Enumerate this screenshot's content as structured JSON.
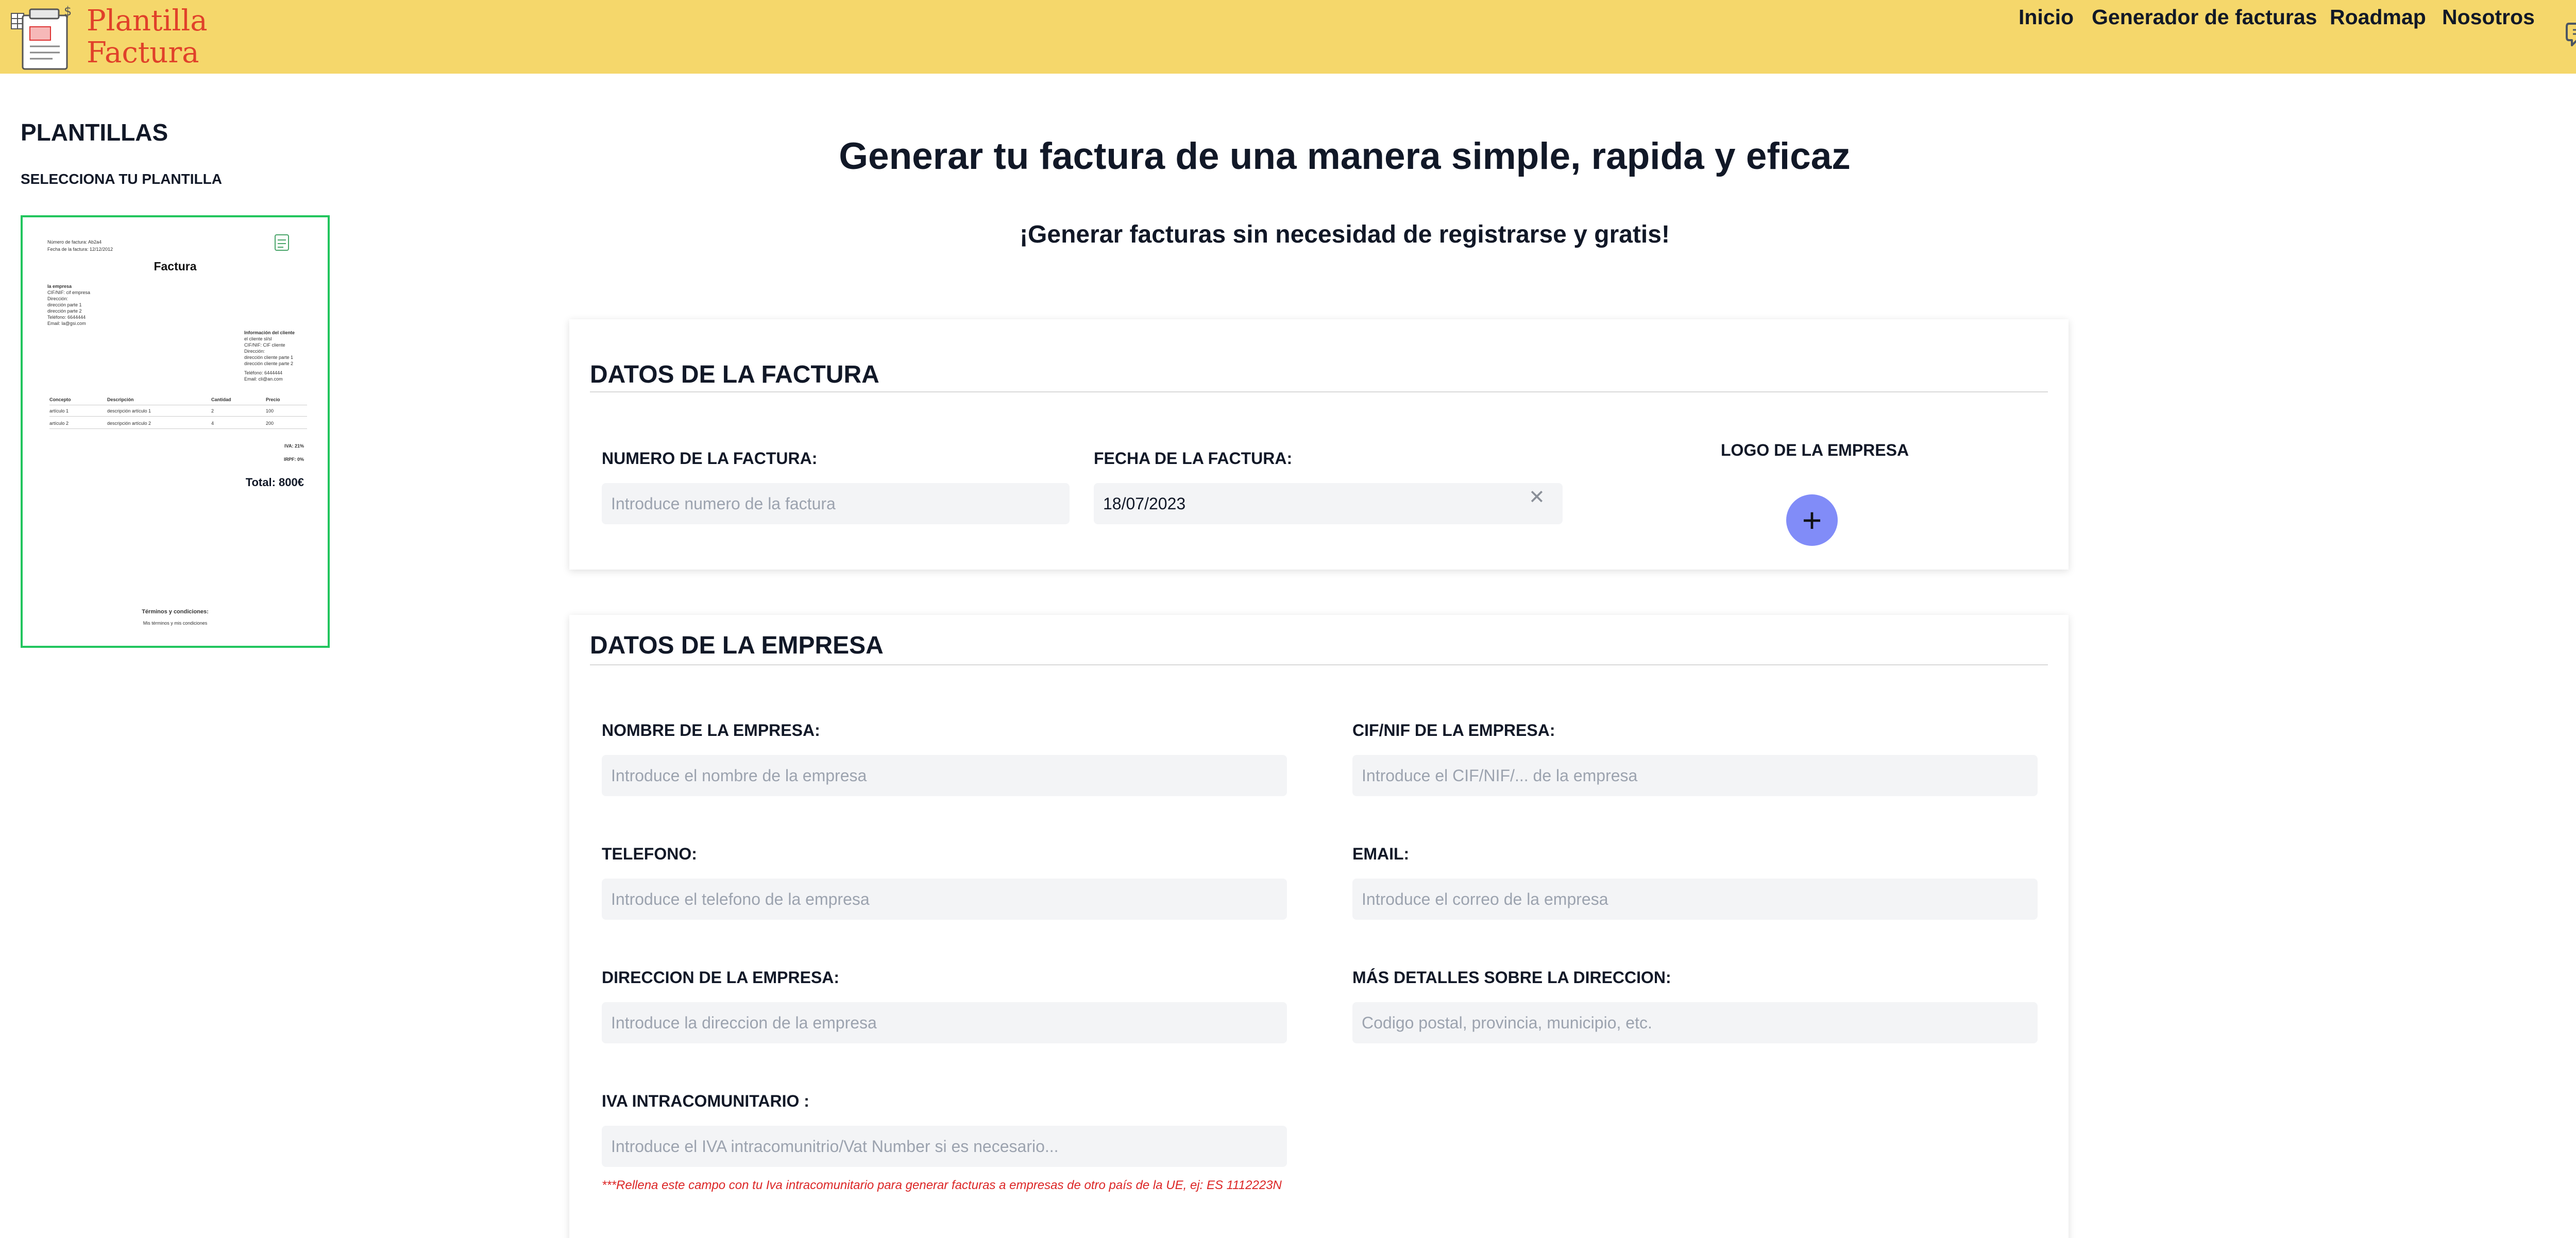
{
  "header": {
    "brand_line1": "Plantilla",
    "brand_line2": "Factura",
    "nav": [
      "Inicio",
      "Generador de facturas",
      "Roadmap",
      "Nosotros"
    ],
    "colors": {
      "background": "#f5d76b",
      "brand": "#e0412a"
    },
    "chat_icon": "chat-bubbles-icon"
  },
  "sidebar": {
    "title": "PLANTILLAS",
    "subtitle": "SELECCIONA TU PLANTILLA",
    "template_preview": {
      "invoice_number": "Número de factura: Ab2a4",
      "invoice_date": "Fecha de la factura: 12/12/2012",
      "title": "Factura",
      "company_block": [
        "la empresa",
        "CIF/NIF: cif empresa",
        "Dirección:",
        "dirección parte 1",
        "dirección parte 2",
        "Teléfono: 6644444",
        "Email: la@gsi.com"
      ],
      "client_block": [
        "Información del cliente",
        "el cliente sl/sl",
        "CIF/NIF: CIF cliente",
        "Dirección:",
        "dirección cliente parte 1",
        "dirección cliente parte 2",
        "Teléfono: 6444444",
        "Email: cli@an.com"
      ],
      "table_headers": [
        "Concepto",
        "Descripción",
        "Cantidad",
        "Precio"
      ],
      "rows": [
        [
          "artículo 1",
          "descripción artículo 1",
          "2",
          "100"
        ],
        [
          "artículo 2",
          "descripción artículo 2",
          "4",
          "200"
        ]
      ],
      "iva": "IVA: 21%",
      "irpf": "IRPF: 0%",
      "total": "Total: 800€",
      "terms_title": "Términos y condiciones:",
      "terms_text": "Mis términos y mis condiciones"
    }
  },
  "main": {
    "title": "Generar tu factura de una manera simple, rapida y eficaz",
    "subtitle": "¡Generar facturas sin necesidad de registrarse y gratis!",
    "invoice_section": {
      "title": "DATOS DE LA FACTURA",
      "number_label": "NUMERO DE LA FACTURA:",
      "number_placeholder": "Introduce numero de la factura",
      "date_label": "FECHA DE LA FACTURA:",
      "date_value": "18/07/2023",
      "logo_label": "LOGO DE LA EMPRESA",
      "add_icon": "plus-icon",
      "clear_icon": "close-icon",
      "accent": "#818cf8"
    },
    "company_section": {
      "title": "DATOS DE LA EMPRESA",
      "name_label": "NOMBRE DE LA EMPRESA:",
      "name_placeholder": "Introduce el nombre de la empresa",
      "cif_label": "CIF/NIF DE LA EMPRESA:",
      "cif_placeholder": "Introduce el CIF/NIF/... de la empresa",
      "phone_label": "TELEFONO:",
      "phone_placeholder": "Introduce el telefono de la empresa",
      "email_label": "EMAIL:",
      "email_placeholder": "Introduce el correo de la empresa",
      "address_label": "DIRECCION DE LA EMPRESA:",
      "address_placeholder": "Introduce la direccion de la empresa",
      "address_details_label": "MÁS DETALLES SOBRE LA DIRECCION:",
      "address_details_placeholder": "Codigo postal, provincia, municipio, etc.",
      "vat_label": "IVA INTRACOMUNITARIO :",
      "vat_placeholder": "Introduce el IVA intracomunitrio/Vat Number si es necesario...",
      "vat_note": "***Rellena este campo con tu Iva intracomunitario para generar facturas a empresas de otro país de la UE, ej: ES 1112223N",
      "note_color": "#dc2626"
    }
  }
}
